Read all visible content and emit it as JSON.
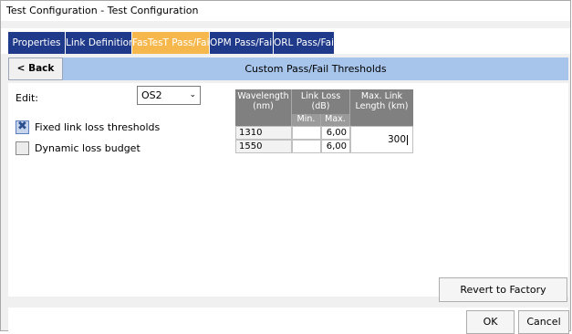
{
  "window": {
    "title": "Test Configuration - Test Configuration"
  },
  "tabs": [
    {
      "label": "Properties"
    },
    {
      "label": "Link Definition"
    },
    {
      "label": "FasTesT Pass/Fail",
      "active": true
    },
    {
      "label": "OPM Pass/Fail"
    },
    {
      "label": "ORL Pass/Fail"
    }
  ],
  "nav": {
    "back_label": "< Back",
    "title": "Custom Pass/Fail Thresholds"
  },
  "form": {
    "edit_label": "Edit:",
    "edit_value": "OS2",
    "fixed_label": "Fixed link loss thresholds",
    "fixed_checked": true,
    "dynamic_label": "Dynamic loss budget",
    "dynamic_checked": false
  },
  "table": {
    "col_wavelength": "Wavelength (nm)",
    "col_link_loss": "Link Loss (dB)",
    "col_min": "Min.",
    "col_max": "Max.",
    "col_length": "Max. Link Length (km)",
    "rows": [
      {
        "wavelength": "1310",
        "min": "",
        "max": "6,00"
      },
      {
        "wavelength": "1550",
        "min": "",
        "max": "6,00"
      }
    ],
    "length_value": "300"
  },
  "buttons": {
    "revert": "Revert to Factory Settings",
    "ok": "OK",
    "cancel": "Cancel"
  },
  "colors": {
    "tab_bg": "#1f3a8a",
    "tab_active": "#f6b84c",
    "header_bar": "#a7c4ea",
    "table_header": "#808080"
  }
}
